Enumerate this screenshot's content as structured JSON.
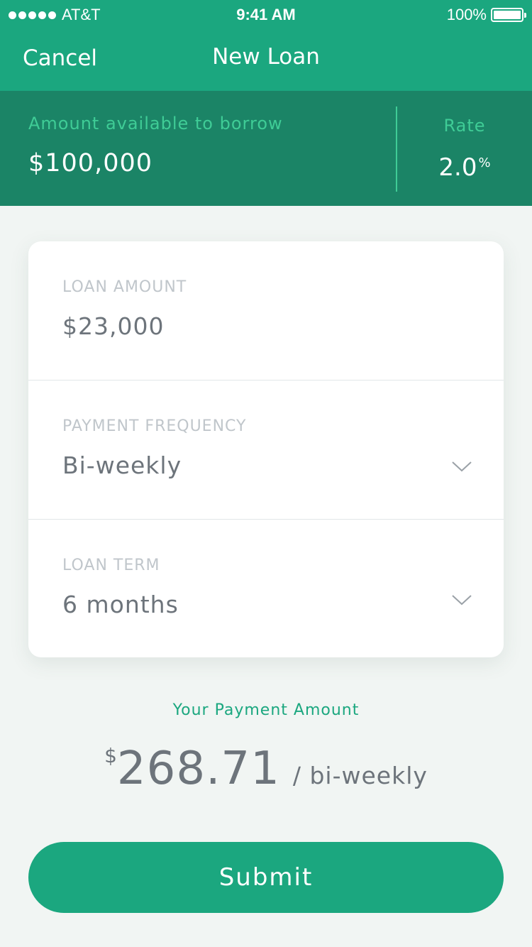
{
  "status_bar": {
    "carrier": "AT&T",
    "time": "9:41 AM",
    "battery": "100%",
    "signal_icon": "signal-dots-icon",
    "battery_icon": "battery-icon"
  },
  "nav": {
    "cancel_label": "Cancel",
    "title": "New Loan"
  },
  "summary": {
    "available_label": "Amount available to borrow",
    "available_value": "$100,000",
    "rate_label": "Rate",
    "rate_value": "2.0",
    "rate_unit": "%"
  },
  "form": {
    "loan_amount": {
      "label": "LOAN AMOUNT",
      "value": "$23,000"
    },
    "payment_frequency": {
      "label": "PAYMENT FREQUENCY",
      "value": "Bi-weekly",
      "icon": "chevron-down-icon"
    },
    "loan_term": {
      "label": "LOAN TERM",
      "value": "6 months",
      "icon": "chevron-down-icon"
    }
  },
  "payment": {
    "label": "Your Payment Amount",
    "currency": "$",
    "amount": "268.71",
    "period": "/ bi-weekly"
  },
  "submit_label": "Submit",
  "colors": {
    "primary": "#1ba77f",
    "primary_dark": "#1b8466",
    "accent_light": "#3fcc96",
    "background": "#f1f5f3",
    "text_gray": "#6d747b",
    "label_gray": "#c0c6cb"
  }
}
